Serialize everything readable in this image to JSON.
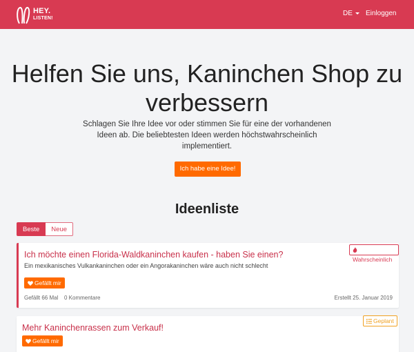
{
  "colors": {
    "brand": "#d83a52",
    "accent": "#ff6a00",
    "planned": "#f0a020"
  },
  "navbar": {
    "logo_line1": "HEY.",
    "logo_line2": "LISTEN!",
    "language": "DE",
    "login": "Einloggen"
  },
  "hero": {
    "title": "Helfen Sie uns, Kaninchen Shop zu verbessern",
    "subtitle": "Schlagen Sie Ihre Idee vor oder stimmen Sie für eine der vorhandenen Ideen ab. Die beliebtesten Ideen werden höchstwahrscheinlich implementiert.",
    "cta": "Ich habe eine Idee!"
  },
  "ideas": {
    "title": "Ideenliste",
    "tabs": [
      {
        "label": "Beste"
      },
      {
        "label": "Neue"
      }
    ],
    "items": [
      {
        "title": "Ich möchte einen Florida-Waldkaninchen kaufen - haben Sie einen?",
        "description": "Ein mexikanisches Vulkankaninchen oder ein Angorakaninchen wäre auch nicht schlecht",
        "status": "Wahrscheinlich",
        "status_icon": "fire-icon",
        "like_label": "Gefällt mir",
        "likes": "Gefällt 66 Mal",
        "comments": "0 Kommentare",
        "created": "Erstellt 25. Januar 2019"
      },
      {
        "title": "Mehr Kaninchenrassen zum Verkauf!",
        "status": "Geplant",
        "status_icon": "list-icon",
        "like_label": "Gefällt mir"
      }
    ]
  }
}
